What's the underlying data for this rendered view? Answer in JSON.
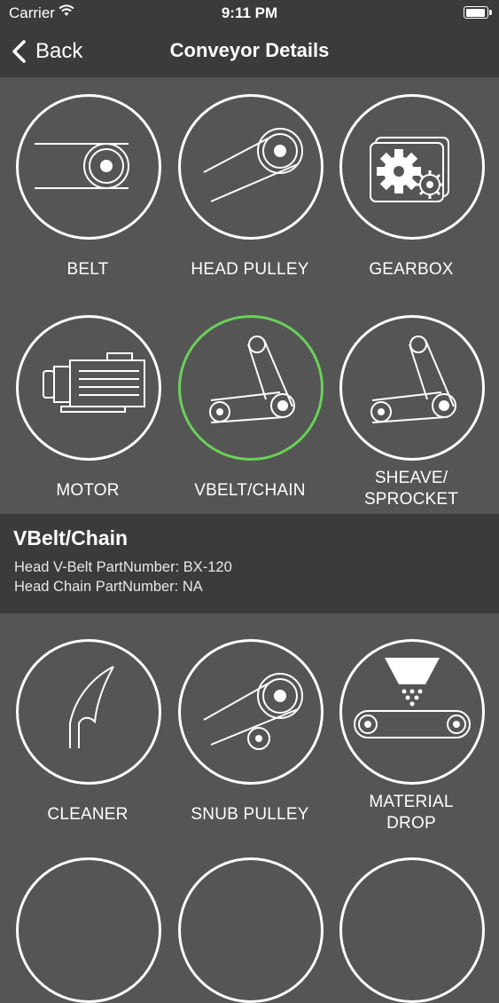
{
  "status_bar": {
    "carrier": "Carrier",
    "time": "9:11 PM",
    "battery_level": 1.0
  },
  "nav": {
    "back_label": "Back",
    "title": "Conveyor Details"
  },
  "row1": [
    {
      "label": "BELT",
      "icon": "belt-icon"
    },
    {
      "label": "HEAD PULLEY",
      "icon": "head-pulley-icon"
    },
    {
      "label": "GEARBOX",
      "icon": "gearbox-icon"
    }
  ],
  "row2": [
    {
      "label": "MOTOR",
      "icon": "motor-icon"
    },
    {
      "label": "VBELT/CHAIN",
      "icon": "vbelt-chain-icon",
      "selected": true
    },
    {
      "label_line1": "SHEAVE/",
      "label_line2": "SPROCKET",
      "icon": "sheave-sprocket-icon"
    }
  ],
  "detail": {
    "title": "VBelt/Chain",
    "line1": "Head V-Belt PartNumber: BX-120",
    "line2": "Head Chain PartNumber: NA"
  },
  "row3": [
    {
      "label": "CLEANER",
      "icon": "cleaner-icon"
    },
    {
      "label": "SNUB PULLEY",
      "icon": "snub-pulley-icon"
    },
    {
      "label_line1": "MATERIAL",
      "label_line2": "DROP",
      "icon": "material-drop-icon"
    }
  ],
  "colors": {
    "background": "#555555",
    "bars": "#3b3b3b",
    "selected_ring": "#69d157",
    "foreground": "#ffffff"
  }
}
